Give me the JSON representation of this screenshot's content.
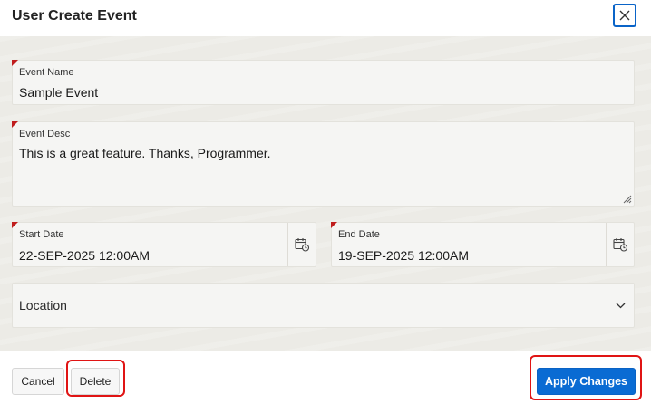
{
  "dialog": {
    "title": "User Create Event"
  },
  "form": {
    "event_name": {
      "label": "Event Name",
      "value": "Sample Event"
    },
    "event_desc": {
      "label": "Event Desc",
      "value": "This is a great feature. Thanks, Programmer."
    },
    "start_date": {
      "label": "Start Date",
      "value": "22-SEP-2025 12:00AM"
    },
    "end_date": {
      "label": "End Date",
      "value": "19-SEP-2025 12:00AM"
    },
    "location": {
      "placeholder": "Location"
    }
  },
  "footer": {
    "cancel_label": "Cancel",
    "delete_label": "Delete",
    "apply_label": "Apply Changes"
  },
  "colors": {
    "primary": "#0a6bd3",
    "required_marker": "#c01d1d",
    "annotation": "#e01414"
  }
}
